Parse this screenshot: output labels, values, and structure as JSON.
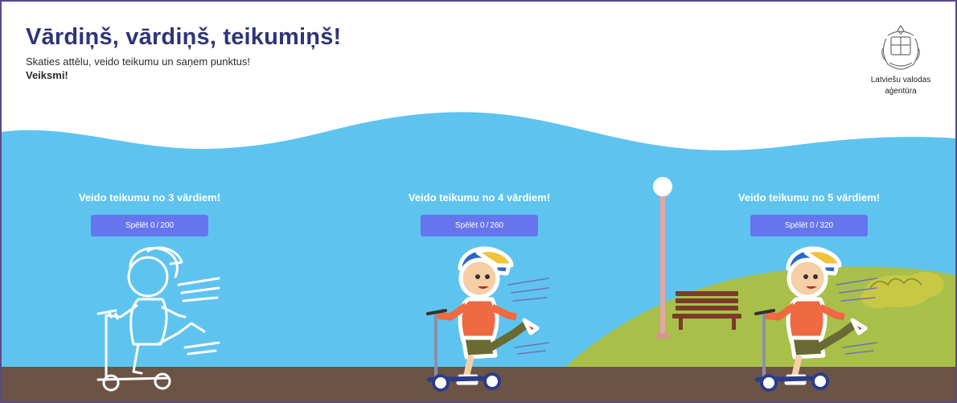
{
  "header": {
    "title": "Vārdiņš, vārdiņš, teikumiņš!",
    "subtitle": "Skaties attēlu, veido teikumu un saņem punktus!",
    "subtitle_bold": "Veiksmi!"
  },
  "logo": {
    "line1": "Latviešu valodas",
    "line2": "aģentūra"
  },
  "levels": [
    {
      "title": "Veido teikumu no 3 vārdiem!",
      "button_prefix": "Spēlēt",
      "score": "0",
      "max": "200",
      "character_state": "locked-outline"
    },
    {
      "title": "Veido teikumu no 4 vārdiem!",
      "button_prefix": "Spēlēt",
      "score": "0",
      "max": "260",
      "character_state": "colored"
    },
    {
      "title": "Veido teikumu no 5 vārdiem!",
      "button_prefix": "Spēlēt",
      "score": "0",
      "max": "320",
      "character_state": "colored"
    }
  ],
  "colors": {
    "sky": "#5ec4ef",
    "ground": "#6b5446",
    "grass": "#a8c04a",
    "button": "#6674ee",
    "title": "#2f3478"
  }
}
